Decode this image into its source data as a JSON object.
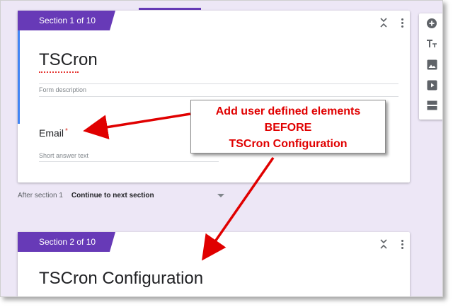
{
  "section1": {
    "tab_label": "Section 1 of 10",
    "title": "TSCron",
    "description_placeholder": "Form description",
    "question": {
      "label": "Email",
      "required_mark": "*",
      "answer_placeholder": "Short answer text"
    }
  },
  "navigation": {
    "after_label": "After section 1",
    "selected_option": "Continue to next section"
  },
  "section2": {
    "tab_label": "Section 2 of 10",
    "title": "TSCron Configuration"
  },
  "callout": {
    "line1": "Add user defined elements",
    "line2": "BEFORE",
    "line3": "TSCron Configuration"
  },
  "toolbar": {
    "items": [
      "add-question-icon",
      "add-title-icon",
      "add-image-icon",
      "add-video-icon",
      "add-section-icon"
    ]
  },
  "colors": {
    "accent": "#673ab7",
    "background": "#ede7f6",
    "annotation": "#e00000"
  }
}
